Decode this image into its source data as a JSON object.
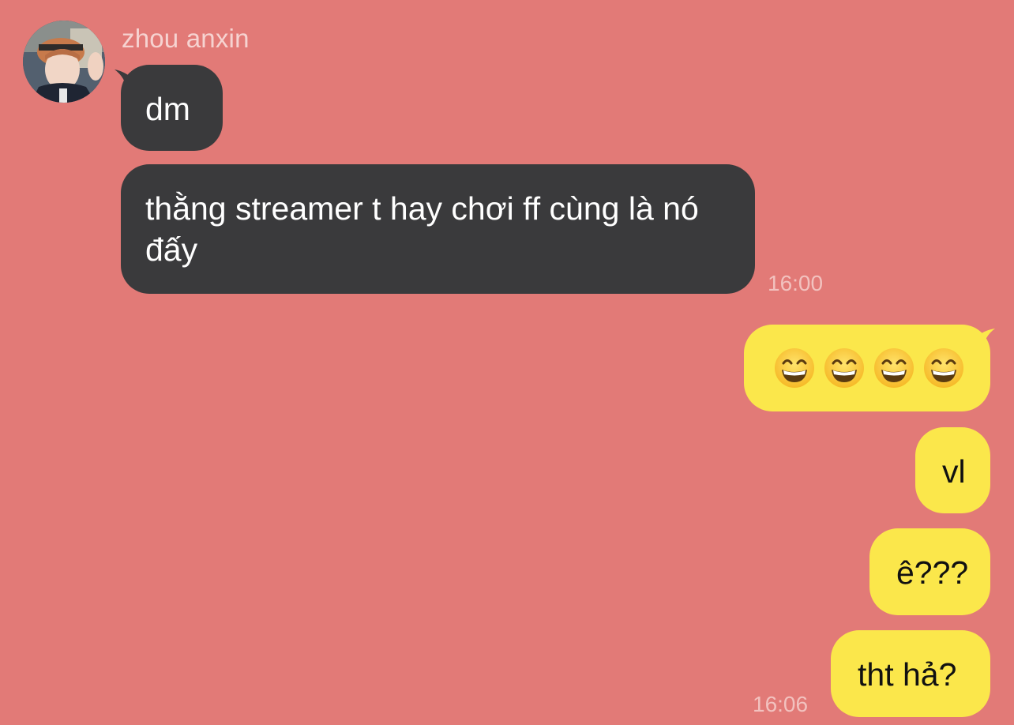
{
  "sender": {
    "name": "zhou anxin"
  },
  "messages": [
    {
      "from": "them",
      "text": "dm"
    },
    {
      "from": "them",
      "text": "thằng streamer t hay chơi ff cùng là nó đấy"
    },
    {
      "from": "me",
      "emoji": [
        "grinning-face-with-smiling-eyes",
        "grinning-face-with-smiling-eyes",
        "grinning-face-with-smiling-eyes",
        "grinning-face-with-smiling-eyes"
      ]
    },
    {
      "from": "me",
      "text": "vl"
    },
    {
      "from": "me",
      "text": "ê???"
    },
    {
      "from": "me",
      "text": "tht hả?"
    }
  ],
  "timestamps": [
    "16:00",
    "16:06"
  ],
  "colors": {
    "background": "#e27a77",
    "incoming_bubble": "#3a3a3c",
    "outgoing_bubble": "#fbe74b"
  }
}
